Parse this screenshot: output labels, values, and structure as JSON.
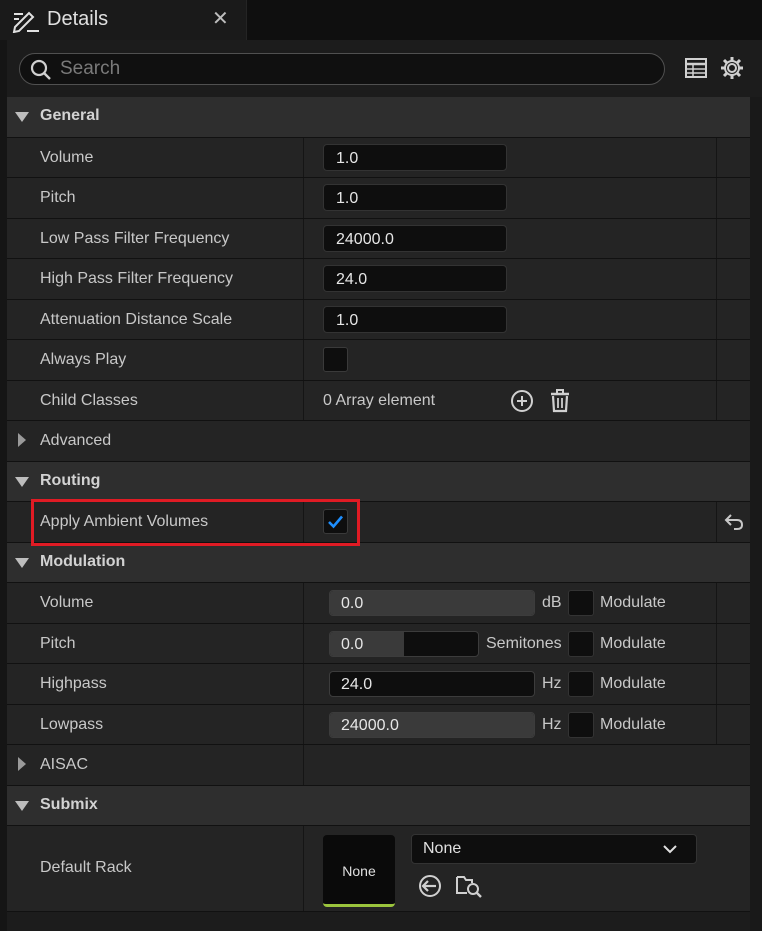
{
  "tab": {
    "title": "Details",
    "close": "✕"
  },
  "search": {
    "placeholder": "Search"
  },
  "sections": {
    "general": "General",
    "advanced": "Advanced",
    "routing": "Routing",
    "modulation": "Modulation",
    "aisac": "AISAC",
    "submix": "Submix"
  },
  "general": {
    "volume": {
      "label": "Volume",
      "value": "1.0"
    },
    "pitch": {
      "label": "Pitch",
      "value": "1.0"
    },
    "lpf": {
      "label": "Low Pass Filter Frequency",
      "value": "24000.0"
    },
    "hpf": {
      "label": "High Pass Filter Frequency",
      "value": "24.0"
    },
    "atten": {
      "label": "Attenuation Distance Scale",
      "value": "1.0"
    },
    "always_play": {
      "label": "Always Play",
      "checked": false
    },
    "child_classes": {
      "label": "Child Classes",
      "value": "0 Array element"
    }
  },
  "routing": {
    "apply_ambient": {
      "label": "Apply Ambient Volumes",
      "checked": true
    }
  },
  "modulation": {
    "volume": {
      "label": "Volume",
      "value": "0.0",
      "unit": "dB",
      "modulate": "Modulate",
      "fill": 1.0
    },
    "pitch": {
      "label": "Pitch",
      "value": "0.0",
      "unit": "Semitones",
      "modulate": "Modulate",
      "fill": 0.5
    },
    "highpass": {
      "label": "Highpass",
      "value": "24.0",
      "unit": "Hz",
      "modulate": "Modulate",
      "fill": 0.0
    },
    "lowpass": {
      "label": "Lowpass",
      "value": "24000.0",
      "unit": "Hz",
      "modulate": "Modulate",
      "fill": 1.0
    }
  },
  "submix": {
    "default_rack": {
      "label": "Default Rack",
      "thumb": "None",
      "value": "None"
    }
  },
  "colors": {
    "accent": "#9bc53d",
    "highlight": "#e01b24",
    "check": "#1e8fff"
  }
}
